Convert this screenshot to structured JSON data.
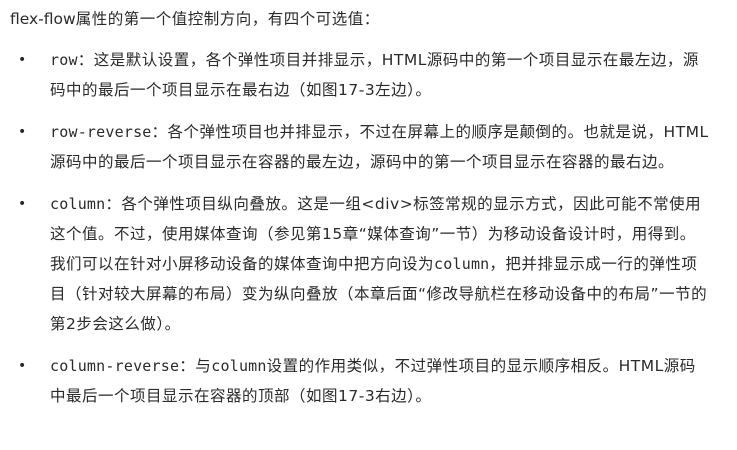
{
  "intro": {
    "lead_code": "flex-flow",
    "text": "属性的第一个值控制方向，有四个可选值："
  },
  "items": [
    {
      "code": "row",
      "parts": [
        {
          "t": "：这是默认设置，各个弹性项目并排显示，HTML源码中的第一个项目显示在最左边，源码中的最后一个项目显示在最右边（如图17-3左边）。"
        }
      ]
    },
    {
      "code": "row-reverse",
      "parts": [
        {
          "t": "：各个弹性项目也并排显示，不过在屏幕上的顺序是颠倒的。也就是说，HTML源码中的最后一个项目显示在容器的最左边，源码中的第一个项目显示在容器的最右边。"
        }
      ]
    },
    {
      "code": "column",
      "parts": [
        {
          "t": "：各个弹性项目纵向叠放。这是一组<div>标签常规的显示方式，因此可能不常使用这个值。不过，使用媒体查询（参见第15章“媒体查询”一节）为移动设备设计时，用得到。我们可以在针对小屏移动设备的媒体查询中把方向设为"
        },
        {
          "c": "column"
        },
        {
          "t": "，把并排显示成一行的弹性项目（针对较大屏幕的布局）变为纵向叠放（本章后面“修改导航栏在移动设备中的布局”一节的第2步会这么做）。"
        }
      ]
    },
    {
      "code": "column-reverse",
      "parts": [
        {
          "t": "：与"
        },
        {
          "c": "column"
        },
        {
          "t": "设置的作用类似，不过弹性项目的显示顺序相反。HTML源码中最后一个项目显示在容器的顶部（如图17-3右边）。"
        }
      ]
    }
  ],
  "bullet_symbol": "•"
}
